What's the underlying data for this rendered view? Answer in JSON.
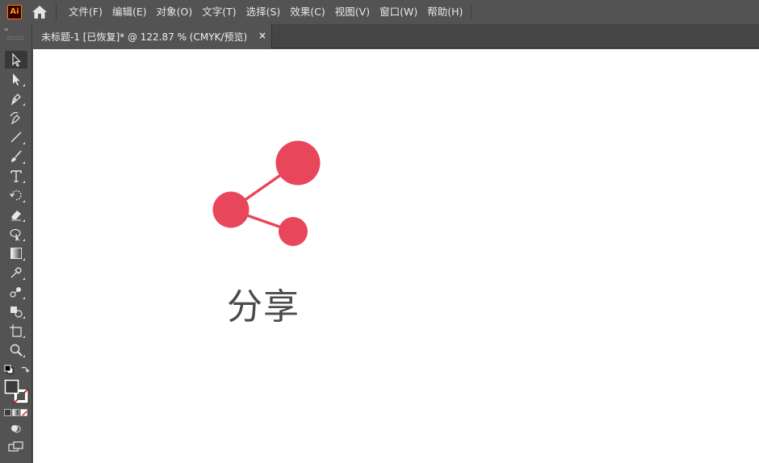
{
  "app": {
    "logo_text": "Ai",
    "logo_colors": {
      "bg": "#330000",
      "fg": "#ff9a00"
    }
  },
  "menu": {
    "items": [
      {
        "label": "文件(F)"
      },
      {
        "label": "编辑(E)"
      },
      {
        "label": "对象(O)"
      },
      {
        "label": "文字(T)"
      },
      {
        "label": "选择(S)"
      },
      {
        "label": "效果(C)"
      },
      {
        "label": "视图(V)"
      },
      {
        "label": "窗口(W)"
      },
      {
        "label": "帮助(H)"
      }
    ]
  },
  "toolbar": {
    "collapse_label": "››",
    "tools": [
      {
        "name": "selection-tool",
        "icon": "arrow-icon"
      },
      {
        "name": "direct-selection-tool",
        "icon": "solid-arrow-icon"
      },
      {
        "name": "pen-tool",
        "icon": "pen-icon"
      },
      {
        "name": "curvature-tool",
        "icon": "curvature-pen-icon"
      },
      {
        "name": "line-tool",
        "icon": "line-icon"
      },
      {
        "name": "paintbrush-tool",
        "icon": "brush-icon"
      },
      {
        "name": "type-tool",
        "icon": "type-icon"
      },
      {
        "name": "rotate-tool",
        "icon": "rotate-icon"
      },
      {
        "name": "eraser-tool",
        "icon": "eraser-icon"
      },
      {
        "name": "puppet-warp-tool",
        "icon": "warp-icon"
      },
      {
        "name": "gradient-tool",
        "icon": "gradient-icon"
      },
      {
        "name": "eyedropper-tool",
        "icon": "eyedropper-icon"
      },
      {
        "name": "blend-tool",
        "icon": "blend-icon"
      },
      {
        "name": "shape-builder-tool",
        "icon": "shape-builder-icon"
      },
      {
        "name": "artboard-tool",
        "icon": "artboard-icon"
      },
      {
        "name": "zoom-tool",
        "icon": "zoom-icon"
      }
    ],
    "fill_color": "#3b3b3b",
    "stroke_color": "none"
  },
  "document": {
    "tab_label": "未标题-1 [已恢复]* @ 122.87 % (CMYK/预览)",
    "close_glyph": "×"
  },
  "artwork": {
    "accent_color": "#e8475b",
    "label": "分享",
    "label_color": "#4a4a4a"
  }
}
